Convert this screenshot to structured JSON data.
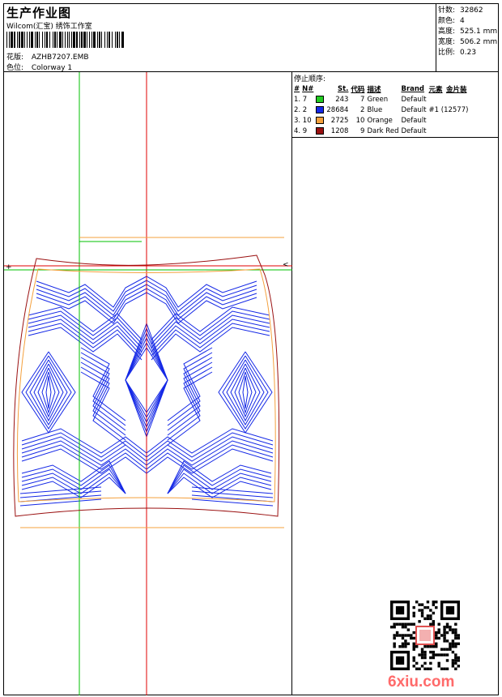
{
  "header": {
    "title": "生产作业图",
    "subtitle": "Wilcom(汇宝) 绣饰工作室",
    "pattern_label": "花版:",
    "pattern_value": "AZHB7207.EMB",
    "color_label": "色位:",
    "color_value": "Colorway 1"
  },
  "specs": [
    {
      "label": "针数:",
      "value": "32862"
    },
    {
      "label": "颜色:",
      "value": "4"
    },
    {
      "label": "高度:",
      "value": "525.1 mm"
    },
    {
      "label": "宽度:",
      "value": "506.2 mm"
    },
    {
      "label": "比例:",
      "value": "0.23"
    }
  ],
  "stop_sequence": {
    "title": "停止顺序:",
    "columns": [
      "#",
      "N#",
      "St.",
      "代码",
      "描述",
      "Brand",
      "元素",
      "金片装"
    ],
    "rows": [
      {
        "index": "1. 7",
        "color": "#22cc22",
        "stitches": "243",
        "code": "7",
        "desc": "Green",
        "brand": "Default",
        "element": ""
      },
      {
        "index": "2. 2",
        "color": "#1428e6",
        "stitches": "28684",
        "code": "2",
        "desc": "Blue",
        "brand": "Default",
        "element": "#1 (12577)"
      },
      {
        "index": "3. 10",
        "color": "#f4a03c",
        "stitches": "2725",
        "code": "10",
        "desc": "Orange",
        "brand": "Default",
        "element": ""
      },
      {
        "index": "4. 9",
        "color": "#9a1010",
        "stitches": "1208",
        "code": "9",
        "desc": "Dark Red",
        "brand": "Default",
        "element": ""
      }
    ]
  },
  "watermark": "6xiu.com",
  "colors": {
    "guide_red": "#e00000",
    "guide_green": "#00c000",
    "outline_orange": "#f4a03c",
    "outline_darkred": "#9a1010",
    "stitch_blue": "#1428e6"
  }
}
